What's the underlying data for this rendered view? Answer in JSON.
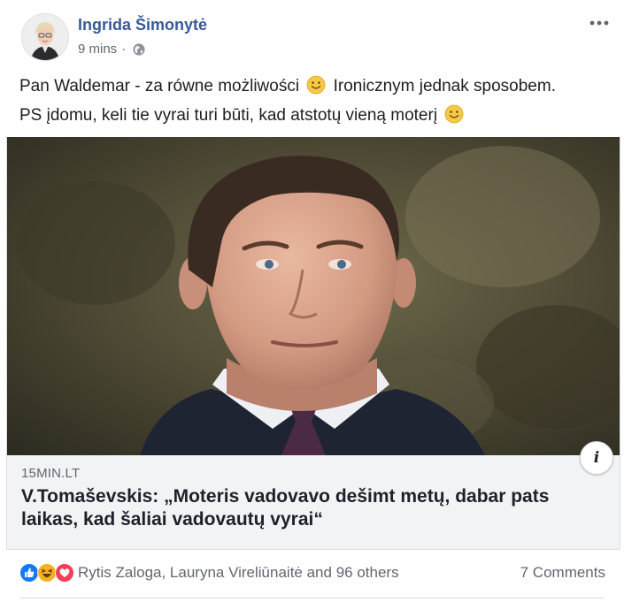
{
  "post": {
    "author": "Ingrida Šimonytė",
    "time": "9 mins",
    "separator": "·",
    "privacy_icon": "globe-icon",
    "text_line1_part1": "Pan Waldemar - za równe możliwości",
    "text_line1_part2": "Ironicznym jednak sposobem.",
    "text_line2": "PS įdomu, keli tie vyrai turi būti, kad atstotų vieną moterį",
    "emoji": "slightly-smiling-face"
  },
  "link_preview": {
    "domain": "15min.lt",
    "headline": "V.Tomaševskis: „Moteris vadovavo dešimt metų, dabar pats laikas, kad šaliai vadovautų vyrai“",
    "info_icon": "i"
  },
  "footer": {
    "reaction_icons": [
      "like-icon",
      "haha-icon",
      "love-icon"
    ],
    "reactors": "Rytis Zaloga, Lauryna Vireliūnaitė and 96 others",
    "comments": "7 Comments"
  },
  "colors": {
    "author_link": "#385898",
    "secondary_text": "#616770",
    "preview_background": "#f2f3f5",
    "like_blue": "#1877f2",
    "love_red": "#f33e58",
    "haha_yellow": "#f7b125"
  }
}
